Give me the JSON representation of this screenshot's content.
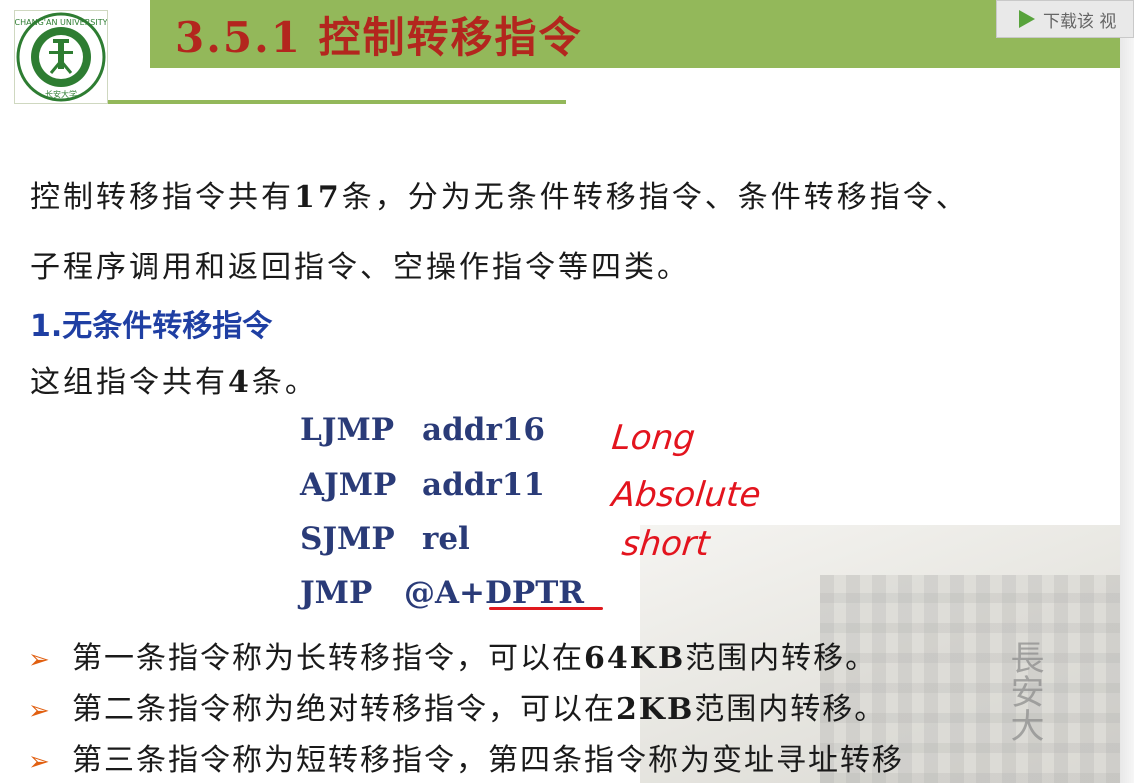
{
  "header": {
    "title": "3.5.1  控制转移指令",
    "band_color": "#93b85a",
    "title_color": "#b3261e"
  },
  "logo": {
    "name": "Chang'an University seal",
    "ring_text": "CHANG'AN UNIVERSITY",
    "inner_text": "长安大学"
  },
  "download_button": {
    "icon": "play-icon",
    "label": "下载该 视"
  },
  "intro": {
    "line1_a": "控制转移指令共有",
    "line1_num": "17",
    "line1_b": "条，分为无条件转移指令、条件转移指令、",
    "line2": "子程序调用和返回指令、空操作指令等四类。"
  },
  "section": {
    "heading": "1.无条件转移指令",
    "count_a": "这组指令共有",
    "count_num": "4",
    "count_b": "条。"
  },
  "instructions": [
    {
      "op": "LJMP",
      "arg": "addr16"
    },
    {
      "op": "AJMP",
      "arg": "addr11"
    },
    {
      "op": "SJMP",
      "arg": "rel"
    },
    {
      "op": "JMP",
      "arg_a": "@A+",
      "arg_b": "DPTR"
    }
  ],
  "annotations": [
    "Long",
    "Absolute",
    "short"
  ],
  "bullets": [
    {
      "a": "第一条指令称为长转移指令，可以在",
      "b": "64KB",
      "c": "范围内转移。"
    },
    {
      "a": "第二条指令称为绝对转移指令，可以在",
      "b": "2KB",
      "c": "范围内转移。"
    },
    {
      "a": "第三条指令称为短转移指令，第四条指令称为变址寻址转移",
      "b": "",
      "c": ""
    }
  ],
  "colors": {
    "heading_blue": "#1f3fa3",
    "instruction_navy": "#2a3b78",
    "ink_red": "#e3141e",
    "bullet_orange": "#e15f10"
  }
}
